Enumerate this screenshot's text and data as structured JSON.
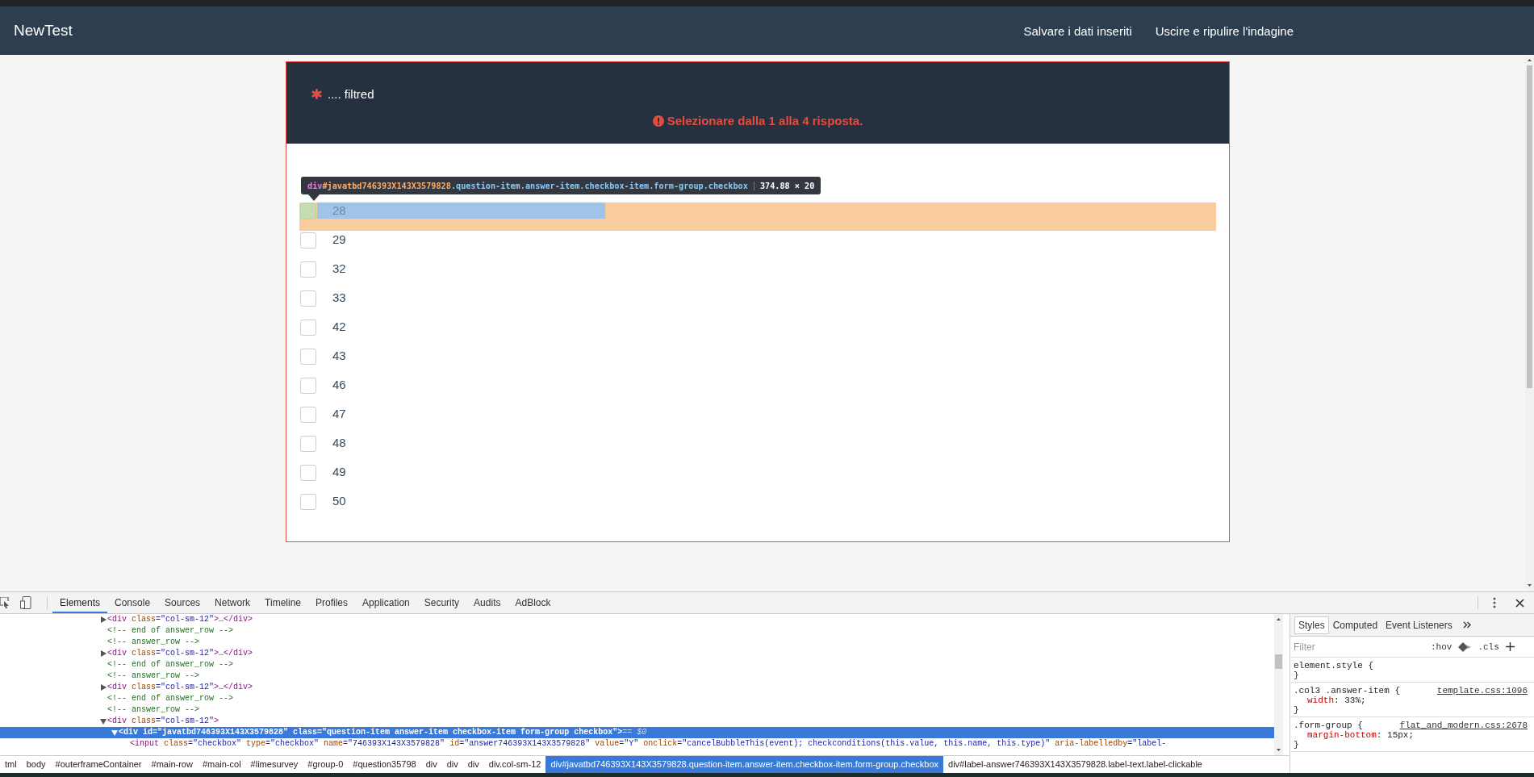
{
  "navbar": {
    "brand": "NewTest",
    "links": [
      "Salvare i dati inseriti",
      "Uscire e ripulire l'indagine"
    ]
  },
  "question": {
    "mandatory": true,
    "title": ".... filtred",
    "error": "Selezionare dalla 1 alla 4 risposta.",
    "answers": [
      {
        "label": "28",
        "checked": false,
        "inspected": true
      },
      {
        "label": "29",
        "checked": false,
        "inspected": false
      },
      {
        "label": "32",
        "checked": false,
        "inspected": false
      },
      {
        "label": "33",
        "checked": false,
        "inspected": false
      },
      {
        "label": "42",
        "checked": false,
        "inspected": false
      },
      {
        "label": "43",
        "checked": false,
        "inspected": false
      },
      {
        "label": "46",
        "checked": false,
        "inspected": false
      },
      {
        "label": "47",
        "checked": false,
        "inspected": false
      },
      {
        "label": "48",
        "checked": false,
        "inspected": false
      },
      {
        "label": "49",
        "checked": false,
        "inspected": false
      },
      {
        "label": "50",
        "checked": false,
        "inspected": false
      }
    ]
  },
  "inspector_tooltip": {
    "tag": "div",
    "id": "#javatbd746393X143X3579828",
    "classes": ".question-item.answer-item.checkbox-item.form-group.checkbox",
    "size": "374.88 × 20"
  },
  "devtools": {
    "tabs": [
      {
        "label": "Elements",
        "selected": true
      },
      {
        "label": "Console",
        "selected": false
      },
      {
        "label": "Sources",
        "selected": false
      },
      {
        "label": "Network",
        "selected": false
      },
      {
        "label": "Timeline",
        "selected": false
      },
      {
        "label": "Profiles",
        "selected": false
      },
      {
        "label": "Application",
        "selected": false
      },
      {
        "label": "Security",
        "selected": false
      },
      {
        "label": "Audits",
        "selected": false
      },
      {
        "label": "AdBlock",
        "selected": false
      }
    ],
    "dom_tree": [
      {
        "kind": "element",
        "expanded": false,
        "selected": false,
        "parts": [
          {
            "kind": "tag",
            "text": "<div"
          },
          {
            "kind": "attr",
            "text": " class"
          },
          {
            "kind": "value",
            "text": "=\"col-sm-12\""
          },
          {
            "kind": "tag",
            "text": ">"
          },
          {
            "kind": "plain",
            "text": "…"
          },
          {
            "kind": "tag",
            "text": "</div>"
          }
        ]
      },
      {
        "kind": "comment",
        "text": "<!-- end of answer_row -->"
      },
      {
        "kind": "comment",
        "text": "<!-- answer_row -->"
      },
      {
        "kind": "element",
        "expanded": false,
        "selected": false,
        "parts": [
          {
            "kind": "tag",
            "text": "<div"
          },
          {
            "kind": "attr",
            "text": " class"
          },
          {
            "kind": "value",
            "text": "=\"col-sm-12\""
          },
          {
            "kind": "tag",
            "text": ">"
          },
          {
            "kind": "plain",
            "text": "…"
          },
          {
            "kind": "tag",
            "text": "</div>"
          }
        ]
      },
      {
        "kind": "comment",
        "text": "<!-- end of answer_row -->"
      },
      {
        "kind": "comment",
        "text": "<!-- answer_row -->"
      },
      {
        "kind": "element",
        "expanded": false,
        "selected": false,
        "parts": [
          {
            "kind": "tag",
            "text": "<div"
          },
          {
            "kind": "attr",
            "text": " class"
          },
          {
            "kind": "value",
            "text": "=\"col-sm-12\""
          },
          {
            "kind": "tag",
            "text": ">"
          },
          {
            "kind": "plain",
            "text": "…"
          },
          {
            "kind": "tag",
            "text": "</div>"
          }
        ]
      },
      {
        "kind": "comment",
        "text": "<!-- end of answer_row -->"
      },
      {
        "kind": "comment",
        "text": "<!-- answer_row -->"
      },
      {
        "kind": "element",
        "expanded": true,
        "selected": false,
        "parts": [
          {
            "kind": "tag",
            "text": "<div"
          },
          {
            "kind": "attr",
            "text": " class"
          },
          {
            "kind": "value",
            "text": "=\"col-sm-12\""
          },
          {
            "kind": "tag",
            "text": ">"
          }
        ],
        "children": [
          {
            "kind": "element",
            "expanded": true,
            "selected": true,
            "parts": [
              {
                "kind": "tag",
                "text": "<div"
              },
              {
                "kind": "attr",
                "text": " id"
              },
              {
                "kind": "value",
                "text": "=\"javatbd746393X143X3579828\""
              },
              {
                "kind": "attr",
                "text": " class"
              },
              {
                "kind": "value",
                "text": "=\"question-item answer-item checkbox-item form-group  checkbox\""
              },
              {
                "kind": "tag",
                "text": ">"
              },
              {
                "kind": "marker",
                "text": " == $0"
              }
            ],
            "children": [
              {
                "kind": "element",
                "selected": false,
                "parts": [
                  {
                    "kind": "tag",
                    "text": "<input"
                  },
                  {
                    "kind": "attr",
                    "text": " class"
                  },
                  {
                    "kind": "value",
                    "text": "=\"checkbox\""
                  },
                  {
                    "kind": "attr",
                    "text": " type"
                  },
                  {
                    "kind": "value",
                    "text": "=\"checkbox\""
                  },
                  {
                    "kind": "attr",
                    "text": " name"
                  },
                  {
                    "kind": "value",
                    "text": "=\"746393X143X3579828\""
                  },
                  {
                    "kind": "attr",
                    "text": " id"
                  },
                  {
                    "kind": "value",
                    "text": "=\"answer746393X143X3579828\""
                  },
                  {
                    "kind": "attr",
                    "text": " value"
                  },
                  {
                    "kind": "value",
                    "text": "=\"Y\""
                  },
                  {
                    "kind": "attr",
                    "text": " onclick"
                  },
                  {
                    "kind": "value",
                    "text": "=\"cancelBubbleThis(event); checkconditions(this.value, this.name, this.type)\""
                  },
                  {
                    "kind": "attr",
                    "text": " aria-labelledby"
                  },
                  {
                    "kind": "value",
                    "text": "=\"label-"
                  }
                ]
              }
            ]
          }
        ]
      }
    ],
    "breadcrumbs": [
      {
        "label": "tml",
        "selected": false
      },
      {
        "label": "body",
        "selected": false
      },
      {
        "label": "#outerframeContainer",
        "selected": false
      },
      {
        "label": "#main-row",
        "selected": false
      },
      {
        "label": "#main-col",
        "selected": false
      },
      {
        "label": "#limesurvey",
        "selected": false
      },
      {
        "label": "#group-0",
        "selected": false
      },
      {
        "label": "#question35798",
        "selected": false
      },
      {
        "label": "div",
        "selected": false
      },
      {
        "label": "div",
        "selected": false
      },
      {
        "label": "div",
        "selected": false
      },
      {
        "label": "div.col-sm-12",
        "selected": false
      },
      {
        "label": "div#javatbd746393X143X3579828.question-item.answer-item.checkbox-item.form-group.checkbox",
        "selected": true
      },
      {
        "label": "div#label-answer746393X143X3579828.label-text.label-clickable",
        "selected": false
      }
    ],
    "styles_panel": {
      "tabs": [
        {
          "label": "Styles",
          "selected": true
        },
        {
          "label": "Computed",
          "selected": false
        },
        {
          "label": "Event Listeners",
          "selected": false
        }
      ],
      "filter_placeholder": "Filter",
      "toggles": [
        ":hov",
        ".cls"
      ],
      "rules": [
        {
          "selector": "element.style {",
          "close": "}"
        },
        {
          "selector": ".col3 .answer-item {",
          "source": "template.css:1096",
          "close": "}",
          "declarations": [
            {
              "name": "width",
              "rest": ": 33%;"
            }
          ]
        },
        {
          "selector": ".form-group {",
          "source": "flat_and_modern.css:2678",
          "close": "}",
          "declarations": [
            {
              "name": "margin-bottom",
              "rest": ": 15px;"
            }
          ]
        }
      ]
    }
  }
}
